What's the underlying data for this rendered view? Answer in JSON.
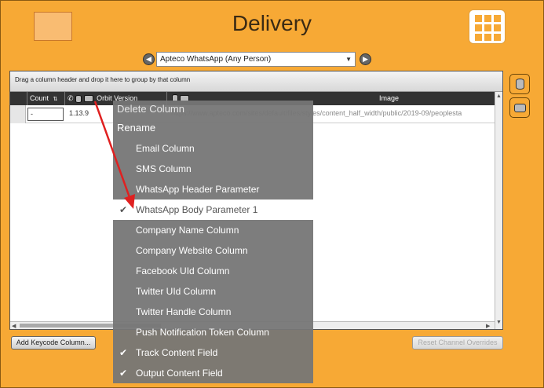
{
  "header": {
    "title": "Delivery"
  },
  "toolbar": {
    "selected_source": "Apteco WhatsApp (Any Person)"
  },
  "grid": {
    "group_hint": "Drag a column header and drop it here to group by that column",
    "columns": {
      "count": "Count",
      "version": "Orbit Version",
      "image": "Image"
    },
    "row": {
      "count_value": "-",
      "version_value": "1.13.9",
      "image_value": "https://www.apteco.com/sites/default/files/styles/content_half_width/public/2019-09/peoplesta"
    }
  },
  "buttons": {
    "add_keycode": "Add Keycode Column...",
    "reset_overrides": "Reset Channel Overrides"
  },
  "context_menu": {
    "delete_column": "Delete Column",
    "rename": "Rename",
    "items": [
      {
        "label": "Email Column",
        "checked": false
      },
      {
        "label": "SMS Column",
        "checked": false
      },
      {
        "label": "WhatsApp Header Parameter",
        "checked": false
      },
      {
        "label": "WhatsApp Body Parameter 1",
        "checked": true
      },
      {
        "label": "Company Name Column",
        "checked": false
      },
      {
        "label": "Company Website Column",
        "checked": false
      },
      {
        "label": "Facebook UId Column",
        "checked": false
      },
      {
        "label": "Twitter UId Column",
        "checked": false
      },
      {
        "label": "Twitter Handle Column",
        "checked": false
      },
      {
        "label": "Push Notification Token Column",
        "checked": false
      },
      {
        "label": "Track Content Field",
        "checked": true
      },
      {
        "label": "Output Content Field",
        "checked": true
      }
    ],
    "check_glyph": "✔"
  },
  "colors": {
    "accent": "#f7a935",
    "menu_bg": "#767676",
    "arrow": "#e02020"
  }
}
